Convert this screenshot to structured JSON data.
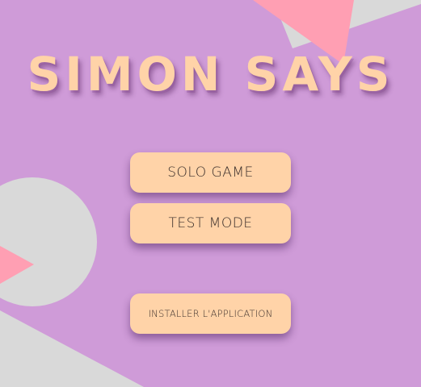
{
  "title": "SIMON SAYS",
  "menu": {
    "solo_label": "SOLO GAME",
    "test_label": "TEST MODE",
    "install_label": "INSTALLER L'APPLICATION"
  },
  "colors": {
    "background": "#cf9bd8",
    "accent_pink": "#ff9fb3",
    "shape_grey": "#d9d9d9",
    "button_peach": "#ffd3a8",
    "title_peach": "#ffd3a8"
  }
}
